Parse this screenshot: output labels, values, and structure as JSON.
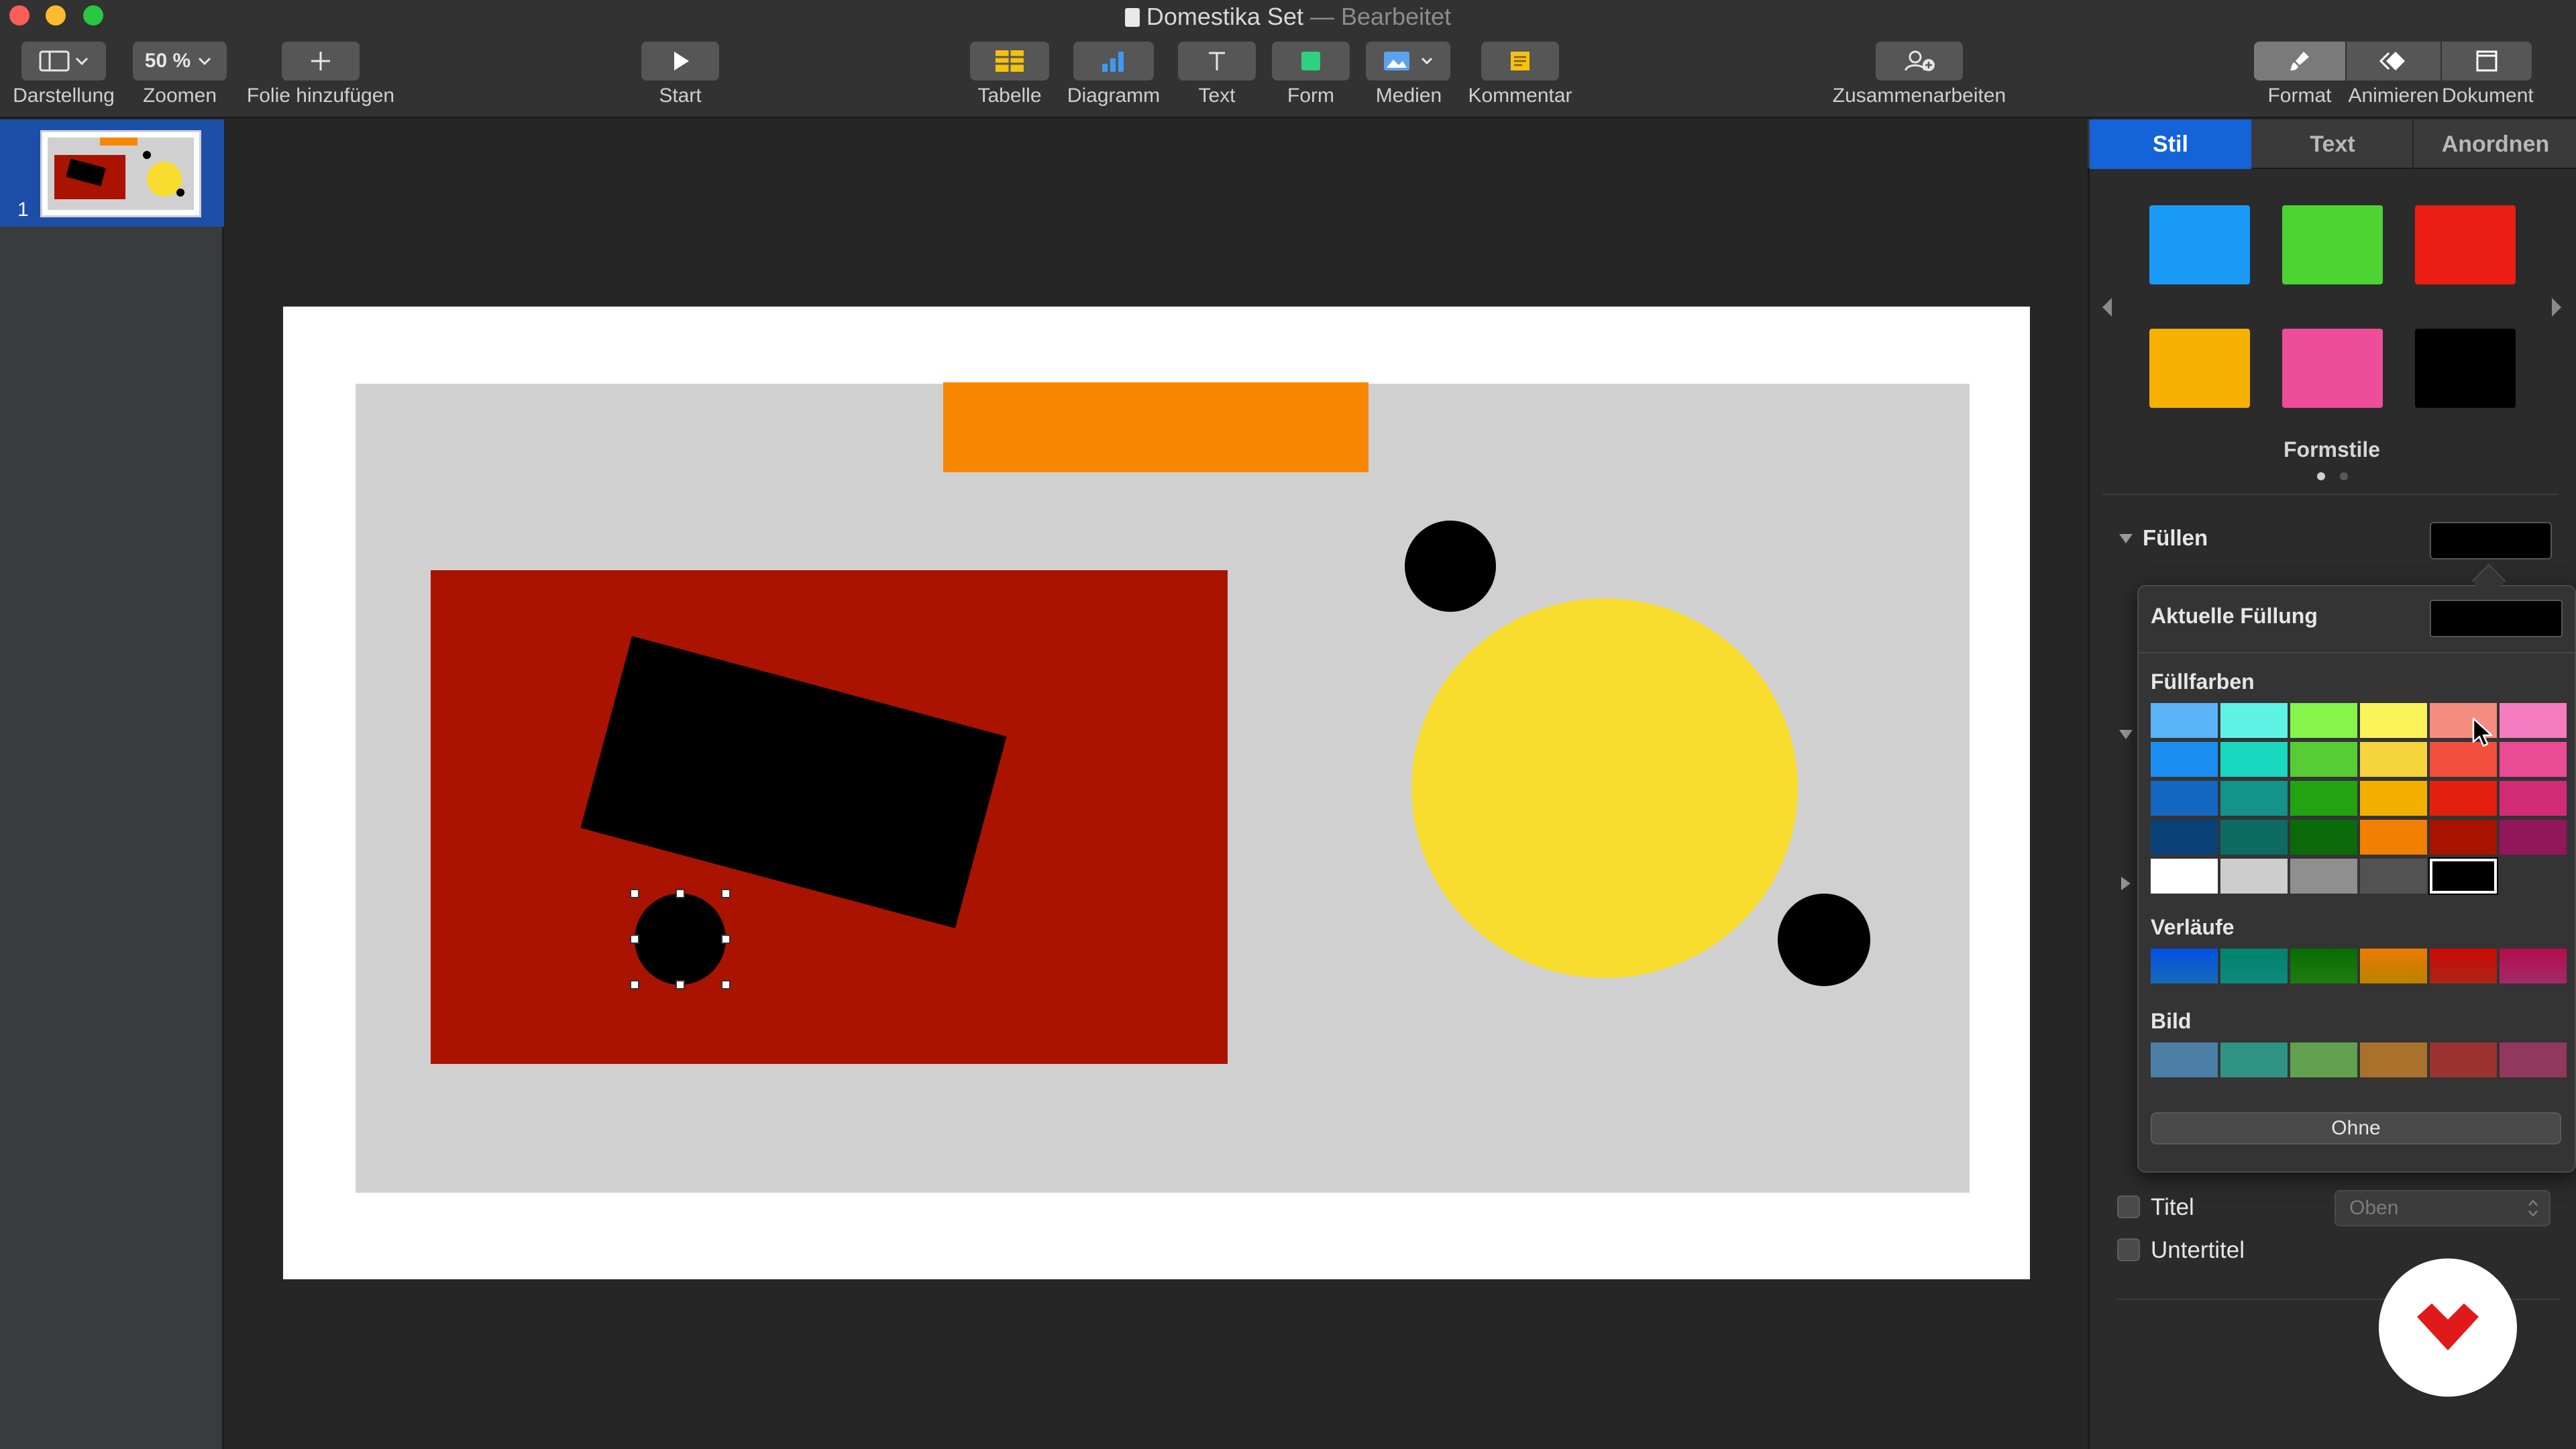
{
  "window": {
    "title": "Domestika Set",
    "title_suffix": "— Bearbeitet"
  },
  "toolbar": {
    "view_label": "Darstellung",
    "zoom_value": "50 %",
    "zoom_label": "Zoomen",
    "add_slide_label": "Folie hinzufügen",
    "play_label": "Start",
    "table_label": "Tabelle",
    "chart_label": "Diagramm",
    "text_label": "Text",
    "shape_label": "Form",
    "media_label": "Medien",
    "comment_label": "Kommentar",
    "collaborate_label": "Zusammenarbeiten",
    "format_label": "Format",
    "animate_label": "Animieren",
    "document_label": "Dokument"
  },
  "sidebar": {
    "slide_number": "1"
  },
  "slide": {
    "colors": {
      "background": "#d0d0d0",
      "orange": "#f78700",
      "red": "#a91300",
      "black": "#000000",
      "yellow": "#f7dc2d"
    }
  },
  "inspector": {
    "tabs": [
      "Stil",
      "Text",
      "Anordnen"
    ],
    "active_tab": "Stil",
    "shape_styles": [
      "#1a9af7",
      "#4cd432",
      "#ec1d12",
      "#f5b000",
      "#ee4d9a",
      "#000000"
    ],
    "shape_styles_label": "Formstile",
    "fill_label": "Füllen",
    "popover": {
      "current_fill_label": "Aktuelle Füllung",
      "fill_colors_label": "Füllfarben",
      "fill_colors": [
        [
          "#5bb3f8",
          "#5ff3e6",
          "#86f44a",
          "#faf45a",
          "#f48d80",
          "#f57cc0"
        ],
        [
          "#1c8ef1",
          "#1ad7c0",
          "#58cc34",
          "#f5d43c",
          "#f24f3e",
          "#e94b95"
        ],
        [
          "#1467c1",
          "#13938a",
          "#21a312",
          "#f4b000",
          "#e31f0e",
          "#d12b78"
        ],
        [
          "#0a4277",
          "#0d6b64",
          "#0b6a09",
          "#f17f00",
          "#a81300",
          "#91165a"
        ],
        [
          "#ffffff",
          "#cdcdcd",
          "#8f8f8f",
          "#525252",
          "#000000",
          ""
        ]
      ],
      "gradients_label": "Verläufe",
      "gradients": [
        "#1c8ef1",
        "#13b7a6",
        "#2ba618",
        "#f5b000",
        "#e3331f",
        "#d63a8b"
      ],
      "image_label": "Bild",
      "images": [
        "#4b7fa6",
        "#2f9384",
        "#62a14f",
        "#a8722c",
        "#9a3231",
        "#92385e"
      ],
      "none_label": "Ohne"
    },
    "title_checkbox_label": "Titel",
    "subtitle_checkbox_label": "Untertitel",
    "title_position_value": "Oben"
  }
}
